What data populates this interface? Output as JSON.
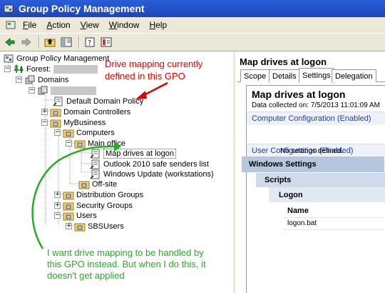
{
  "window": {
    "title": "Group Policy Management"
  },
  "menu": [
    {
      "label": "File",
      "u": "F",
      "rest": "ile"
    },
    {
      "label": "Action",
      "u": "A",
      "rest": "ction"
    },
    {
      "label": "View",
      "u": "V",
      "rest": "iew"
    },
    {
      "label": "Window",
      "u": "W",
      "rest": "indow"
    },
    {
      "label": "Help",
      "u": "H",
      "rest": "elp"
    }
  ],
  "toolbar": [
    "back-arrow-icon",
    "forward-arrow-icon",
    "up-folder-icon",
    "show-hide-tree-icon",
    "properties-icon",
    "help-icon"
  ],
  "tree": {
    "root": "Group Policy Management",
    "forest": "Forest:",
    "domains": "Domains",
    "default_policy": "Default Domain Policy",
    "domain_controllers": "Domain Controllers",
    "mybusiness": "MyBusiness",
    "computers": "Computers",
    "main_office": "Main office",
    "map_drives": "Map drives at logon",
    "outlook": "Outlook 2010 safe senders list",
    "windows_update": "Windows Update (workstations)",
    "offsite": "Off-site",
    "distribution": "Distribution Groups",
    "security": "Security Groups",
    "users": "Users",
    "sbsusers": "SBSUsers"
  },
  "annotations": {
    "red": "Drive mapping currently defined in this GPO",
    "green": "I want drive mapping to be handled by this GPO instead. But when I do this, it doesn't get applied"
  },
  "right": {
    "title": "Map drives at logon",
    "tabs": [
      "Scope",
      "Details",
      "Settings",
      "Delegation"
    ],
    "active_tab": "Settings",
    "heading": "Map drives at logon",
    "collected": "Data collected on: 7/5/2013 11:01:09 AM",
    "computer_config": "Computer Configuration (Enabled)",
    "no_settings": "No settings defined.",
    "user_config": "User Configuration (Enabled)",
    "windows_settings": "Windows Settings",
    "scripts": "Scripts",
    "logon": "Logon",
    "col_name": "Name",
    "value": "logon.bat"
  },
  "colors": {
    "annotation_red": "#e00000",
    "annotation_green": "#22b022",
    "link_blue": "#1f3fa8"
  }
}
